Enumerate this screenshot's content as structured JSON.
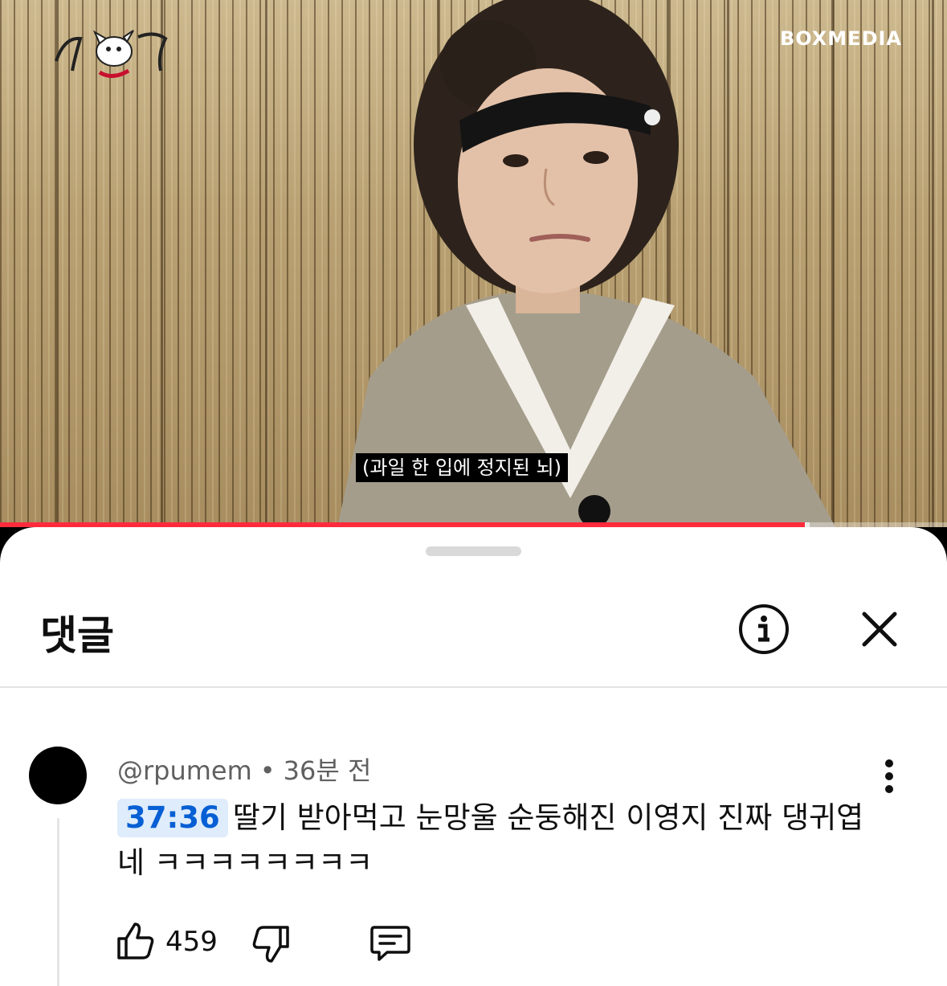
{
  "video": {
    "channel_logo_alt": "channel-logo",
    "brand": "BOXMEDIA",
    "subtitle": "(과일 한 입에 정지된 뇌)",
    "progress_fraction": 0.85,
    "buffer_fraction": 0.855
  },
  "sheet": {
    "title": "댓글",
    "info_icon": "info-icon",
    "close_icon": "close-icon"
  },
  "comment": {
    "author": "@rpumem",
    "separator": "•",
    "time_ago": "36분 전",
    "timestamp": "37:36",
    "text": "딸기 받아먹고 눈망울 순둥해진 이영지 진짜 댕귀엽네 ㅋㅋㅋㅋㅋㅋㅋㅋ",
    "like_count": "459",
    "icons": [
      "more-vertical-icon",
      "thumbs-up-icon",
      "thumbs-down-icon",
      "reply-icon"
    ]
  },
  "colors": {
    "progress": "#ff2b3c",
    "timestamp_bg": "#deecfb",
    "timestamp_fg": "#065fd4",
    "meta": "#606060"
  }
}
